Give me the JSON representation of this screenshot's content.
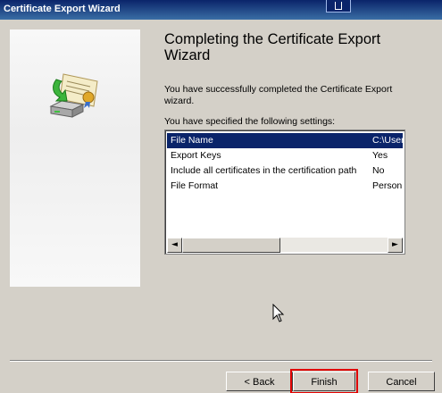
{
  "window": {
    "title": "Certificate Export Wizard"
  },
  "wizard": {
    "heading": "Completing the Certificate Export Wizard",
    "success_text": "You have successfully completed the Certificate Export wizard.",
    "settings_intro": "You have specified the following settings:"
  },
  "settings": [
    {
      "name": "File Name",
      "value": "C:\\User"
    },
    {
      "name": "Export Keys",
      "value": "Yes"
    },
    {
      "name": "Include all certificates in the certification path",
      "value": "No"
    },
    {
      "name": "File Format",
      "value": "Person"
    }
  ],
  "buttons": {
    "back": "< Back",
    "finish": "Finish",
    "cancel": "Cancel"
  },
  "icons": {
    "scroll_left": "◄",
    "scroll_right": "►",
    "certificate": "certificate-export-icon",
    "cursor": "mouse-cursor-icon"
  },
  "colors": {
    "titlebar": "#0a246a",
    "selection": "#0a246a",
    "highlight_border": "#e00000",
    "dialog_bg": "#d4d0c8"
  }
}
